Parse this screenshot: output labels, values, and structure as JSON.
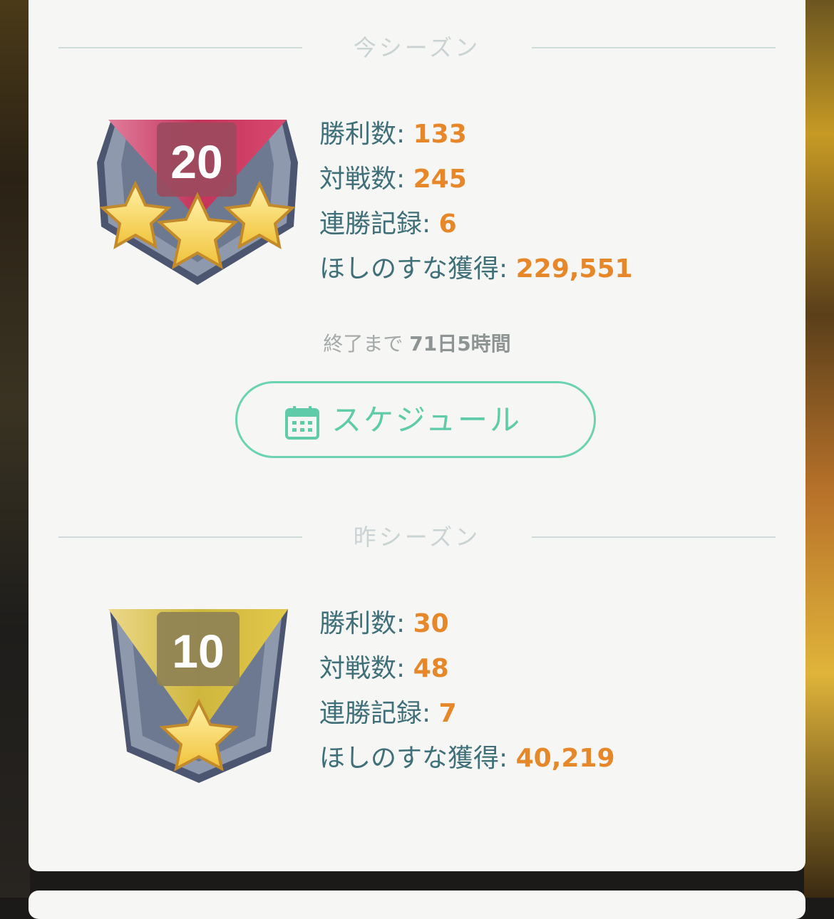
{
  "current_season": {
    "header": "今シーズン",
    "rank": "20",
    "stats": [
      {
        "label": "勝利数:",
        "value": "133"
      },
      {
        "label": "対戦数:",
        "value": "245"
      },
      {
        "label": "連勝記録:",
        "value": "6"
      },
      {
        "label": "ほしのすな獲得:",
        "value": "229,551"
      }
    ],
    "remaining_prefix": "終了まで",
    "remaining_value": "71日5時間",
    "schedule_button": {
      "label": "スケジュール",
      "icon": "calendar-icon"
    }
  },
  "previous_season": {
    "header": "昨シーズン",
    "rank": "10",
    "stats": [
      {
        "label": "勝利数:",
        "value": "30"
      },
      {
        "label": "対戦数:",
        "value": "48"
      },
      {
        "label": "連勝記録:",
        "value": "7"
      },
      {
        "label": "ほしのすな獲得:",
        "value": "40,219"
      }
    ]
  },
  "colors": {
    "accent": "#5fcba8",
    "value": "#e6872a",
    "label": "#3f6f78",
    "current_ribbon": "#c4345a",
    "previous_ribbon": "#d7bd3e"
  }
}
